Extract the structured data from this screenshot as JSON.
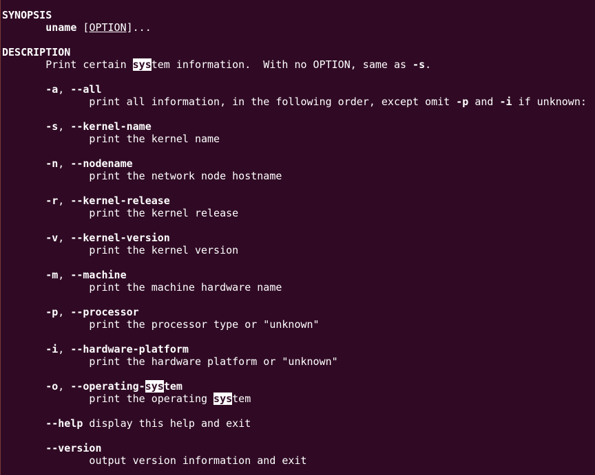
{
  "colors": {
    "background": "#300a24",
    "text": "#ffffff",
    "highlight_bg": "#ffffff",
    "highlight_fg": "#300a24"
  },
  "lines": [
    [
      {
        "t": "SYNOPSIS",
        "s": "b"
      }
    ],
    [
      {
        "t": "       "
      },
      {
        "t": "uname",
        "s": "b"
      },
      {
        "t": " ["
      },
      {
        "t": "OPTION",
        "s": "u"
      },
      {
        "t": "]..."
      }
    ],
    [],
    [
      {
        "t": "DESCRIPTION",
        "s": "b"
      }
    ],
    [
      {
        "t": "       Print certain "
      },
      {
        "t": "sys",
        "s": "h"
      },
      {
        "t": "tem information.  With no OPTION, same as "
      },
      {
        "t": "-s",
        "s": "b"
      },
      {
        "t": "."
      }
    ],
    [],
    [
      {
        "t": "       "
      },
      {
        "t": "-a",
        "s": "b"
      },
      {
        "t": ", "
      },
      {
        "t": "--all",
        "s": "b"
      }
    ],
    [
      {
        "t": "              print all information, in the following order, except omit "
      },
      {
        "t": "-p",
        "s": "b"
      },
      {
        "t": " and "
      },
      {
        "t": "-i",
        "s": "b"
      },
      {
        "t": " if unknown:"
      }
    ],
    [],
    [
      {
        "t": "       "
      },
      {
        "t": "-s",
        "s": "b"
      },
      {
        "t": ", "
      },
      {
        "t": "--kernel-name",
        "s": "b"
      }
    ],
    [
      {
        "t": "              print the kernel name"
      }
    ],
    [],
    [
      {
        "t": "       "
      },
      {
        "t": "-n",
        "s": "b"
      },
      {
        "t": ", "
      },
      {
        "t": "--nodename",
        "s": "b"
      }
    ],
    [
      {
        "t": "              print the network node hostname"
      }
    ],
    [],
    [
      {
        "t": "       "
      },
      {
        "t": "-r",
        "s": "b"
      },
      {
        "t": ", "
      },
      {
        "t": "--kernel-release",
        "s": "b"
      }
    ],
    [
      {
        "t": "              print the kernel release"
      }
    ],
    [],
    [
      {
        "t": "       "
      },
      {
        "t": "-v",
        "s": "b"
      },
      {
        "t": ", "
      },
      {
        "t": "--kernel-version",
        "s": "b"
      }
    ],
    [
      {
        "t": "              print the kernel version"
      }
    ],
    [],
    [
      {
        "t": "       "
      },
      {
        "t": "-m",
        "s": "b"
      },
      {
        "t": ", "
      },
      {
        "t": "--machine",
        "s": "b"
      }
    ],
    [
      {
        "t": "              print the machine hardware name"
      }
    ],
    [],
    [
      {
        "t": "       "
      },
      {
        "t": "-p",
        "s": "b"
      },
      {
        "t": ", "
      },
      {
        "t": "--processor",
        "s": "b"
      }
    ],
    [
      {
        "t": "              print the processor type or \"unknown\""
      }
    ],
    [],
    [
      {
        "t": "       "
      },
      {
        "t": "-i",
        "s": "b"
      },
      {
        "t": ", "
      },
      {
        "t": "--hardware-platform",
        "s": "b"
      }
    ],
    [
      {
        "t": "              print the hardware platform or \"unknown\""
      }
    ],
    [],
    [
      {
        "t": "       "
      },
      {
        "t": "-o",
        "s": "b"
      },
      {
        "t": ", "
      },
      {
        "t": "--operating-",
        "s": "b"
      },
      {
        "t": "sys",
        "s": "h"
      },
      {
        "t": "tem",
        "s": "b"
      }
    ],
    [
      {
        "t": "              print the operating "
      },
      {
        "t": "sys",
        "s": "h"
      },
      {
        "t": "tem"
      }
    ],
    [],
    [
      {
        "t": "       "
      },
      {
        "t": "--help",
        "s": "b"
      },
      {
        "t": " display this help and exit"
      }
    ],
    [],
    [
      {
        "t": "       "
      },
      {
        "t": "--version",
        "s": "b"
      }
    ],
    [
      {
        "t": "              output version information and exit"
      }
    ]
  ]
}
